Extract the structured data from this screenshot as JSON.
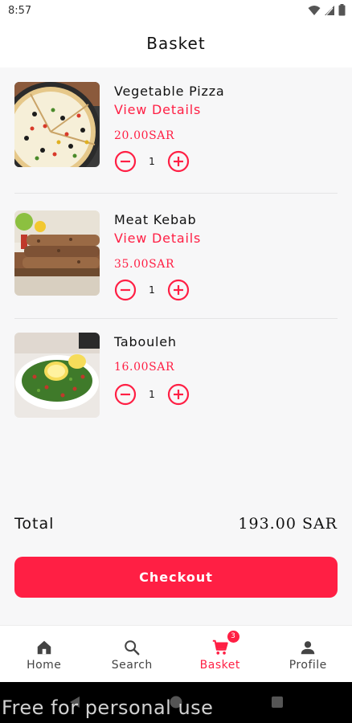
{
  "status_bar": {
    "time": "8:57"
  },
  "header": {
    "title": "Basket"
  },
  "items": [
    {
      "name": "Vegetable Pizza",
      "link": "View Details",
      "price": "20.00SAR",
      "quantity": "1"
    },
    {
      "name": "Meat Kebab",
      "link": "View Details",
      "price": "35.00SAR",
      "quantity": "1"
    },
    {
      "name": "Tabouleh",
      "price": "16.00SAR",
      "quantity": "1"
    }
  ],
  "summary": {
    "total_label": "Total",
    "total_value": "193.00 SAR"
  },
  "checkout": {
    "label": "Checkout"
  },
  "nav": {
    "items": [
      {
        "label": "Home",
        "icon": "home-icon"
      },
      {
        "label": "Search",
        "icon": "search-icon"
      },
      {
        "label": "Basket",
        "icon": "cart-icon",
        "badge": "3",
        "active": true
      },
      {
        "label": "Profile",
        "icon": "person-icon"
      }
    ]
  },
  "watermark": "Free for personal use",
  "colors": {
    "accent": "#ff1f44",
    "background": "#f7f7f8",
    "nav_inactive": "#444444"
  }
}
